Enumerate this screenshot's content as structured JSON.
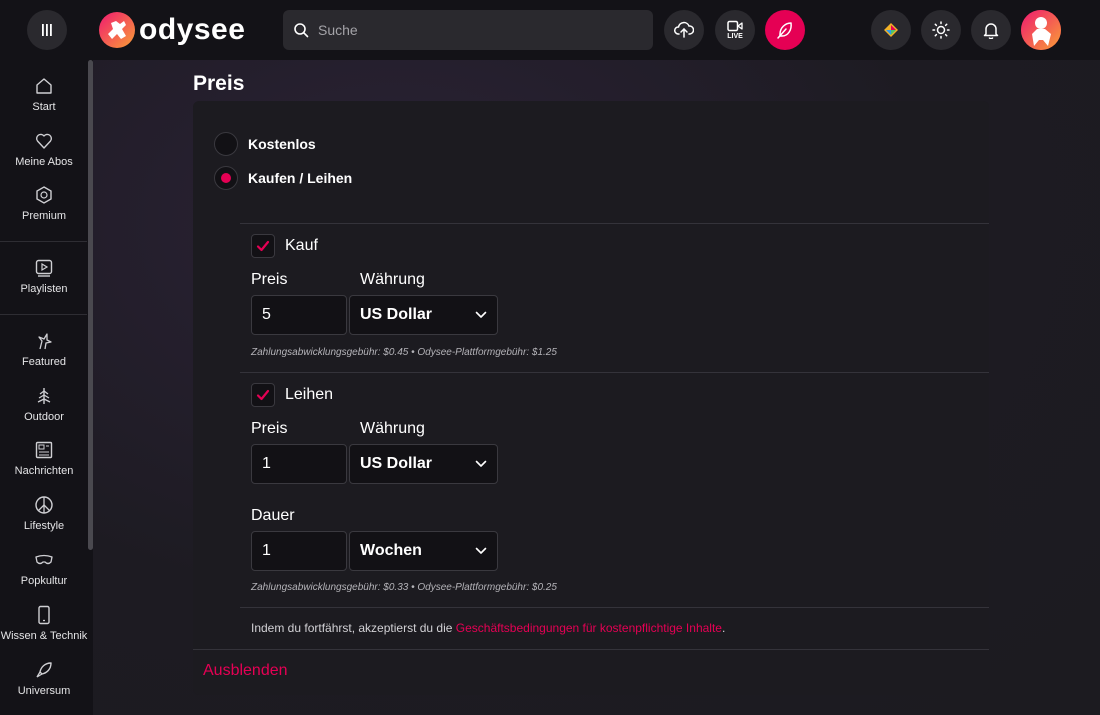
{
  "colors": {
    "accent": "#e50054",
    "background": "#1d1b22",
    "header": "#131217",
    "card": "#1c1b20"
  },
  "header": {
    "logo_text": "odysee",
    "search_placeholder": "Suche",
    "live_label": "LIVE",
    "icons": [
      "menu-icon",
      "upload-icon",
      "live-icon",
      "publish-icon",
      "wallet-icon",
      "theme-icon",
      "bell-icon"
    ]
  },
  "sidebar": {
    "items": [
      {
        "label": "Start",
        "icon": "home-icon"
      },
      {
        "label": "Meine Abos",
        "icon": "heart-icon"
      },
      {
        "label": "Premium",
        "icon": "premium-icon"
      },
      {
        "label": "Playlisten",
        "icon": "playlist-icon"
      },
      {
        "label": "Featured",
        "icon": "featured-icon"
      },
      {
        "label": "Outdoor",
        "icon": "tree-icon"
      },
      {
        "label": "Nachrichten",
        "icon": "news-icon"
      },
      {
        "label": "Lifestyle",
        "icon": "peace-icon"
      },
      {
        "label": "Popkultur",
        "icon": "mask-icon"
      },
      {
        "label": "Wissen & Technik",
        "icon": "phone-icon"
      },
      {
        "label": "Universum",
        "icon": "rocket-icon"
      }
    ]
  },
  "main": {
    "title": "Preis",
    "radio_free": "Kostenlos",
    "radio_paid": "Kaufen / Leihen",
    "purchase": {
      "label": "Kauf",
      "checked": true,
      "price_label": "Preis",
      "currency_label": "Währung",
      "price_value": "5",
      "currency_value": "US Dollar",
      "fee_text": "Zahlungsabwicklungsgebühr: $0.45 • Odysee-Plattformgebühr: $1.25"
    },
    "rent": {
      "label": "Leihen",
      "checked": true,
      "price_label": "Preis",
      "currency_label": "Währung",
      "price_value": "1",
      "currency_value": "US Dollar",
      "duration_label": "Dauer",
      "duration_value": "1",
      "duration_unit": "Wochen",
      "fee_text": "Zahlungsabwicklungsgebühr: $0.33 • Odysee-Plattformgebühr: $0.25"
    },
    "terms_prefix": "Indem du fortfährst, akzeptierst du die ",
    "terms_link": "Geschäftsbedingungen für kostenpflichtige Inhalte",
    "terms_suffix": ".",
    "hide_label": "Ausblenden"
  }
}
